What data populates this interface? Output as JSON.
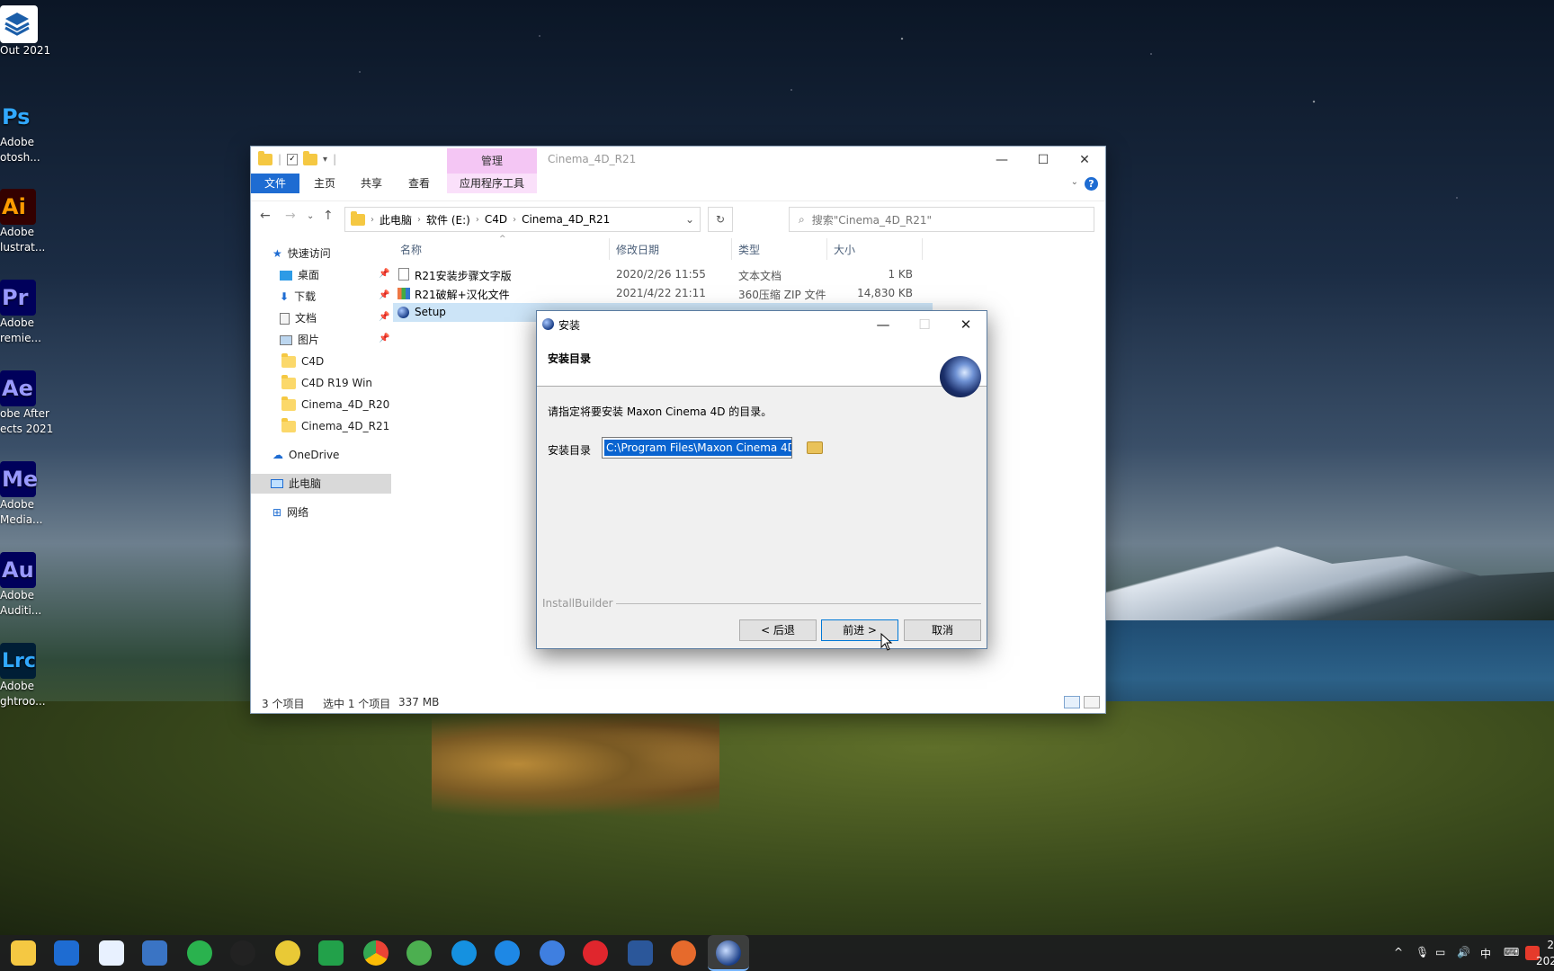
{
  "desktop": {
    "icons": [
      {
        "tile": "",
        "label": "Out 2021",
        "bg": "#ffffff",
        "fg": "#1b5ea9"
      },
      {
        "tile": "Ps",
        "line1": "Adobe",
        "line2": "otosh...",
        "bg": "#001e36",
        "fg": "#31a8ff"
      },
      {
        "tile": "Ai",
        "line1": "Adobe",
        "line2": "lustrat...",
        "bg": "#330000",
        "fg": "#ff9a00"
      },
      {
        "tile": "Pr",
        "line1": "Adobe",
        "line2": "remie...",
        "bg": "#00005b",
        "fg": "#9999ff"
      },
      {
        "tile": "Ae",
        "line1": "obe After",
        "line2": "ects 2021",
        "bg": "#00005b",
        "fg": "#9999ff"
      },
      {
        "tile": "Me",
        "line1": "Adobe",
        "line2": "Media...",
        "bg": "#00005b",
        "fg": "#9999ff"
      },
      {
        "tile": "Au",
        "line1": "Adobe",
        "line2": "Auditi...",
        "bg": "#00005b",
        "fg": "#9999ff"
      },
      {
        "tile": "Lrc",
        "line1": "Adobe",
        "line2": "ghtroo...",
        "bg": "#001e36",
        "fg": "#31a8ff"
      }
    ]
  },
  "explorer": {
    "manage_tab": "管理",
    "title": "Cinema_4D_R21",
    "ribbon_tabs": [
      "文件",
      "主页",
      "共享",
      "查看"
    ],
    "tools_tab": "应用程序工具",
    "breadcrumb": [
      "此电脑",
      "软件 (E:)",
      "C4D",
      "Cinema_4D_R21"
    ],
    "search_placeholder": "搜索\"Cinema_4D_R21\"",
    "nav": {
      "quick_access": "快速访问",
      "pinned": [
        "桌面",
        "下载",
        "文档",
        "图片"
      ],
      "folders": [
        "C4D",
        "C4D R19 Win",
        "Cinema_4D_R20",
        "Cinema_4D_R21"
      ],
      "onedrive": "OneDrive",
      "this_pc": "此电脑",
      "network": "网络"
    },
    "columns": [
      "名称",
      "修改日期",
      "类型",
      "大小"
    ],
    "files": [
      {
        "name": "R21安装步骤文字版",
        "date": "2020/2/26 11:55",
        "type": "文本文档",
        "size": "1 KB"
      },
      {
        "name": "R21破解+汉化文件",
        "date": "2021/4/22 21:11",
        "type": "360压缩 ZIP 文件",
        "size": "14,830 KB"
      },
      {
        "name": "Setup",
        "date": "",
        "type": "",
        "size": ""
      }
    ],
    "status": {
      "count": "3 个项目",
      "selected": "选中 1 个项目",
      "size": "337 MB"
    }
  },
  "dialog": {
    "title": "安装",
    "header": "安装目录",
    "description": "请指定将要安装 Maxon Cinema 4D 的目录。",
    "dir_label": "安装目录",
    "dir_value": "C:\\Program Files\\Maxon Cinema 4D",
    "footer_brand": "InstallBuilder",
    "back_button": "< 后退",
    "next_button": "前进 >",
    "cancel_button": "取消"
  },
  "taskbar": {
    "tray_ime": "中",
    "clock_line1": "2",
    "clock_line2": "202"
  },
  "colors": {
    "accent": "#1e6cd2",
    "selection": "#cce4f7",
    "manage_tab": "#f4c6f4"
  }
}
